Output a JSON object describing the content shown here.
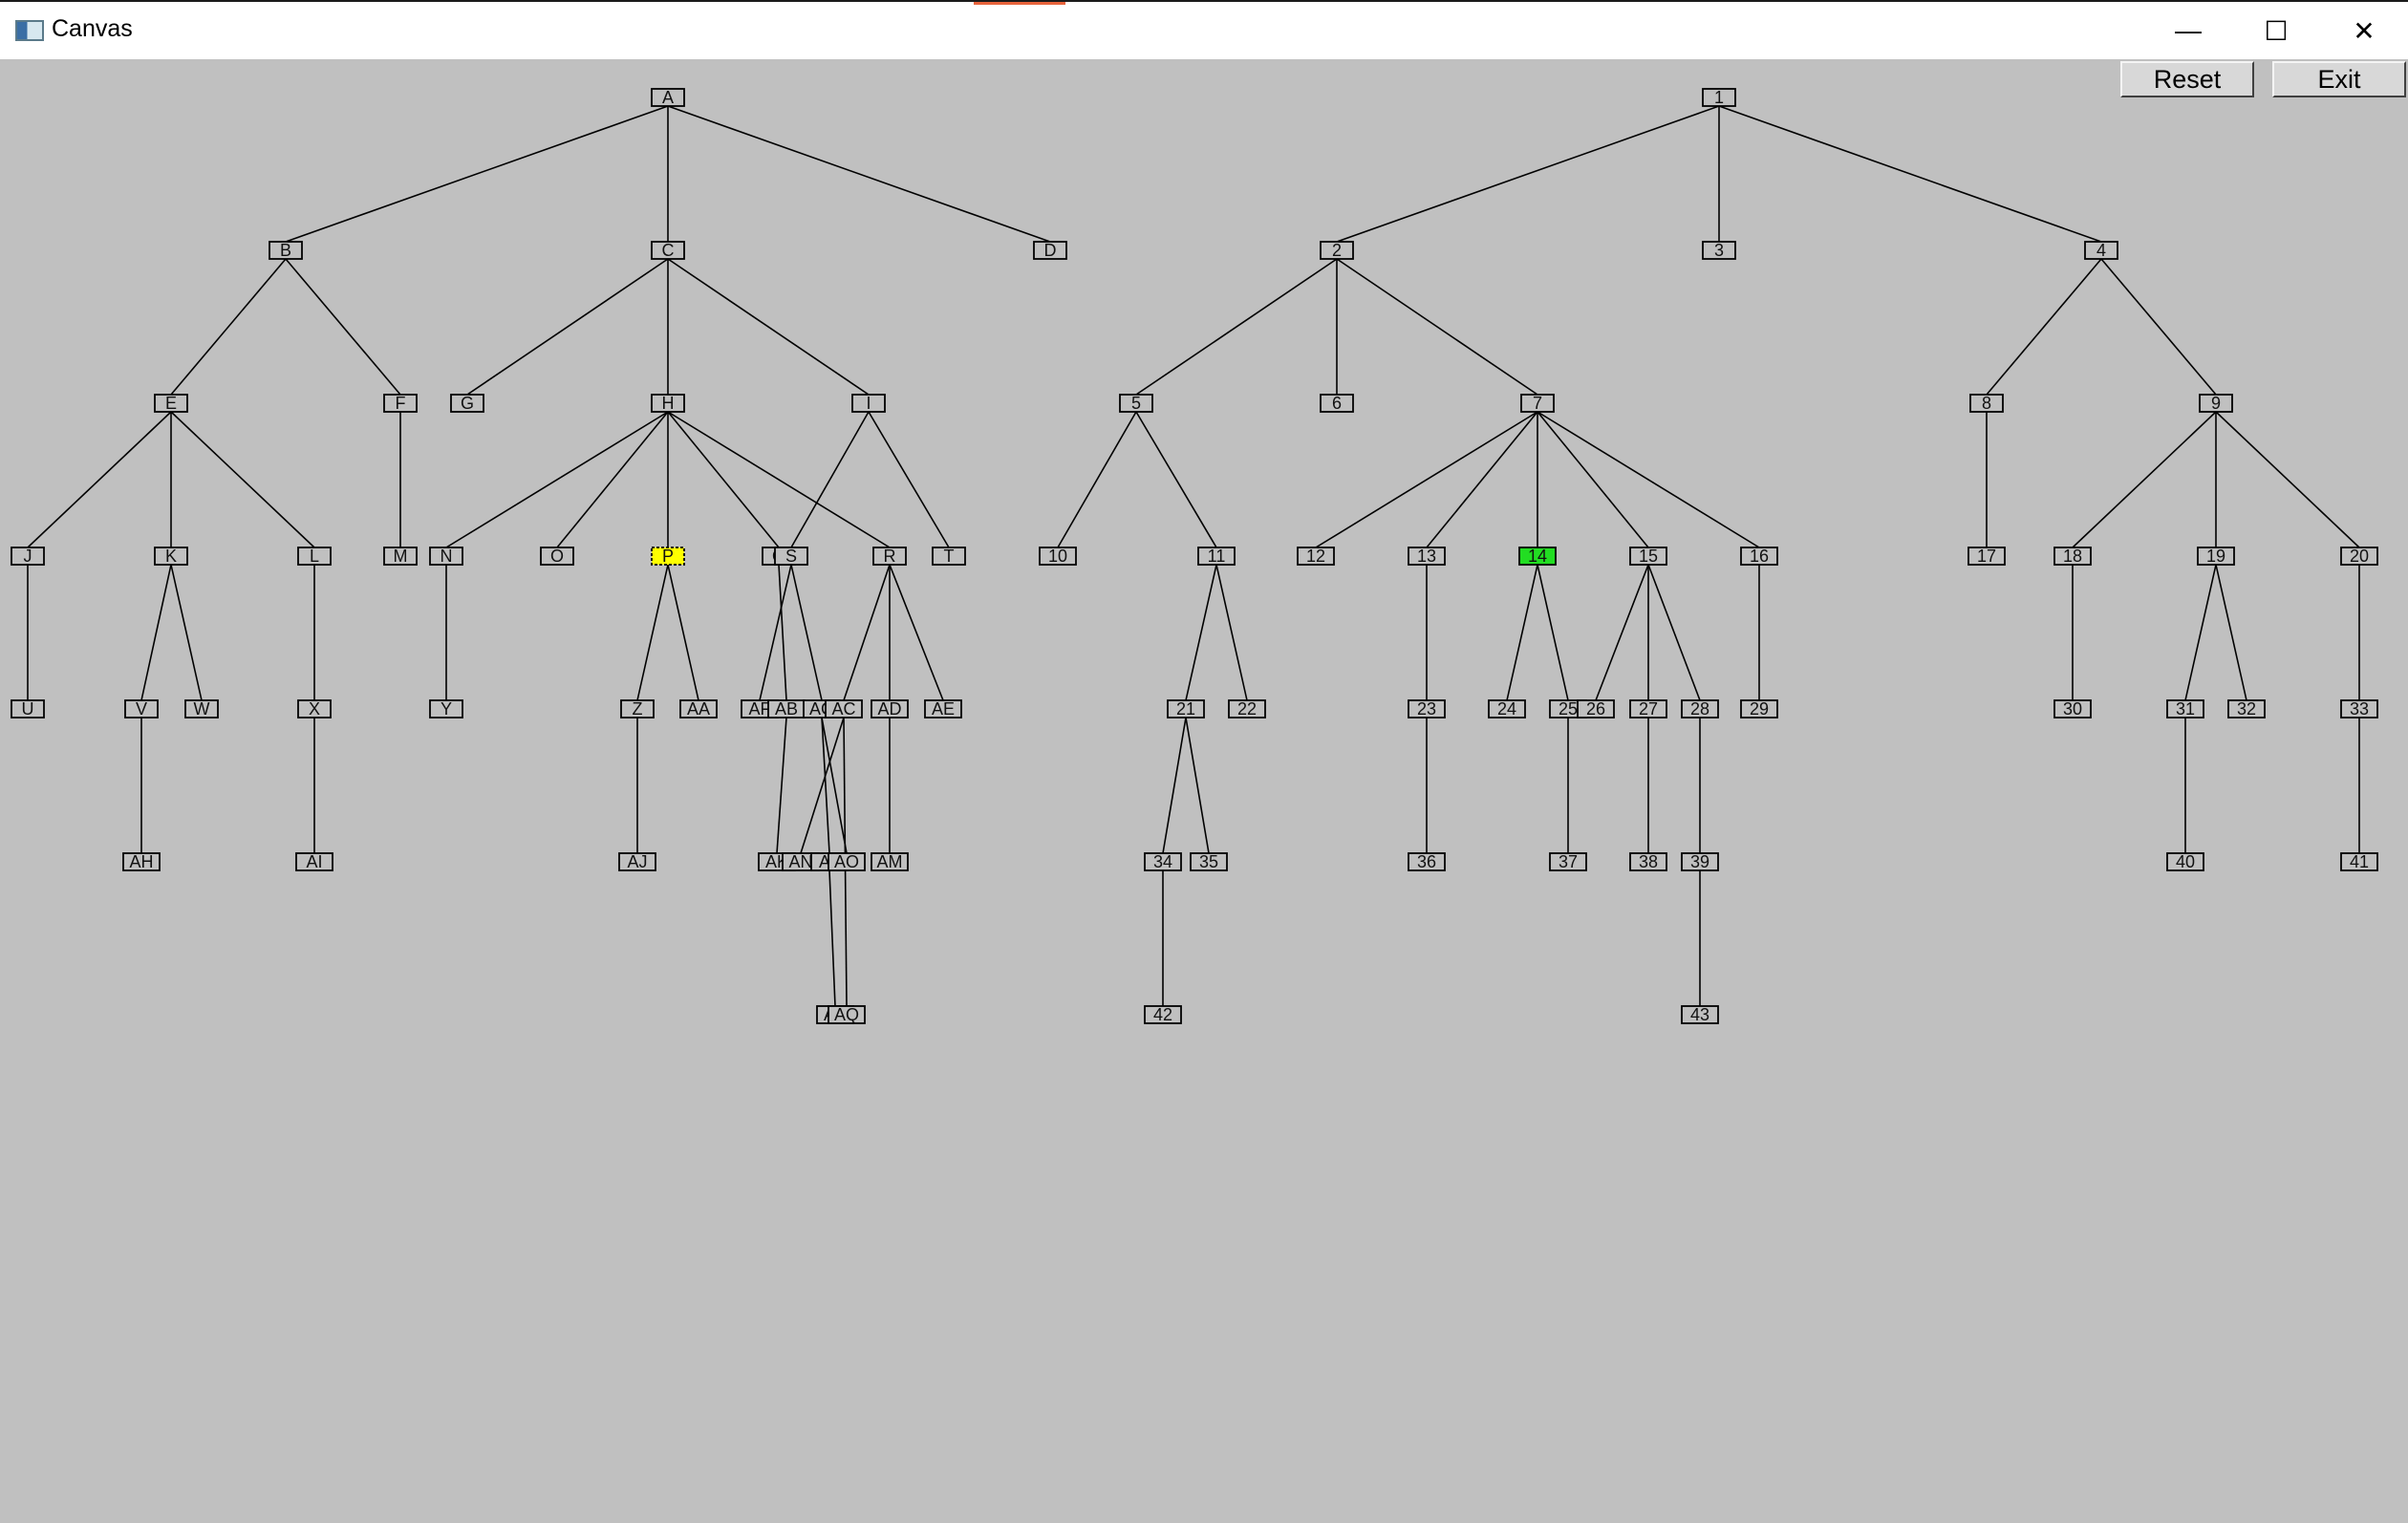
{
  "window": {
    "title": "Canvas",
    "icon": "canvas-app-icon",
    "controls": {
      "minimize": "—",
      "maximize": "☐",
      "close": "✕"
    }
  },
  "toolbar": {
    "reset_label": "Reset",
    "exit_label": "Exit"
  },
  "colors": {
    "background": "#c0c0c0",
    "node_fill": "#c0c0c0",
    "node_border": "#000000",
    "edge": "#000000",
    "highlight_yellow": "#ffff00",
    "highlight_green": "#22dd22"
  },
  "trees": [
    {
      "name": "letter-tree",
      "nodes": [
        {
          "label": "A"
        },
        {
          "label": "B",
          "parent": "A"
        },
        {
          "label": "C",
          "parent": "A"
        },
        {
          "label": "D",
          "parent": "A"
        },
        {
          "label": "E",
          "parent": "B"
        },
        {
          "label": "F",
          "parent": "B"
        },
        {
          "label": "G",
          "parent": "C"
        },
        {
          "label": "H",
          "parent": "C"
        },
        {
          "label": "I",
          "parent": "C"
        },
        {
          "label": "J",
          "parent": "E"
        },
        {
          "label": "K",
          "parent": "E"
        },
        {
          "label": "L",
          "parent": "E"
        },
        {
          "label": "M",
          "parent": "F"
        },
        {
          "label": "N",
          "parent": "H"
        },
        {
          "label": "O",
          "parent": "H"
        },
        {
          "label": "P",
          "parent": "H",
          "highlight": "yellow"
        },
        {
          "label": "Q",
          "parent": "H"
        },
        {
          "label": "R",
          "parent": "H"
        },
        {
          "label": "S",
          "parent": "I"
        },
        {
          "label": "T",
          "parent": "I"
        },
        {
          "label": "U",
          "parent": "J"
        },
        {
          "label": "V",
          "parent": "K"
        },
        {
          "label": "W",
          "parent": "K"
        },
        {
          "label": "X",
          "parent": "L"
        },
        {
          "label": "Y",
          "parent": "N"
        },
        {
          "label": "Z",
          "parent": "P"
        },
        {
          "label": "AA",
          "parent": "P"
        },
        {
          "label": "AF",
          "parent": "S"
        },
        {
          "label": "AB",
          "parent": "Q"
        },
        {
          "label": "AG",
          "parent": "S"
        },
        {
          "label": "AC",
          "parent": "R"
        },
        {
          "label": "AD",
          "parent": "R"
        },
        {
          "label": "AE",
          "parent": "R"
        },
        {
          "label": "AH",
          "parent": "V"
        },
        {
          "label": "AI",
          "parent": "X"
        },
        {
          "label": "AJ",
          "parent": "Z"
        },
        {
          "label": "AK",
          "parent": "AB"
        },
        {
          "label": "AN",
          "parent": "AC"
        },
        {
          "label": "AL",
          "parent": "AG"
        },
        {
          "label": "AO",
          "parent": "AG"
        },
        {
          "label": "AM",
          "parent": "AD"
        },
        {
          "label": "AP",
          "parent": "AL"
        },
        {
          "label": "AQ",
          "parent": "AC"
        }
      ]
    },
    {
      "name": "number-tree",
      "nodes": [
        {
          "label": "1"
        },
        {
          "label": "2",
          "parent": "1"
        },
        {
          "label": "3",
          "parent": "1"
        },
        {
          "label": "4",
          "parent": "1"
        },
        {
          "label": "5",
          "parent": "2"
        },
        {
          "label": "6",
          "parent": "2"
        },
        {
          "label": "7",
          "parent": "2"
        },
        {
          "label": "8",
          "parent": "4"
        },
        {
          "label": "9",
          "parent": "4"
        },
        {
          "label": "10",
          "parent": "5"
        },
        {
          "label": "11",
          "parent": "5"
        },
        {
          "label": "12",
          "parent": "7"
        },
        {
          "label": "13",
          "parent": "7"
        },
        {
          "label": "14",
          "parent": "7",
          "highlight": "green"
        },
        {
          "label": "15",
          "parent": "7"
        },
        {
          "label": "16",
          "parent": "7"
        },
        {
          "label": "17",
          "parent": "8"
        },
        {
          "label": "18",
          "parent": "9"
        },
        {
          "label": "19",
          "parent": "9"
        },
        {
          "label": "20",
          "parent": "9"
        },
        {
          "label": "21",
          "parent": "11"
        },
        {
          "label": "22",
          "parent": "11"
        },
        {
          "label": "23",
          "parent": "13"
        },
        {
          "label": "24",
          "parent": "14"
        },
        {
          "label": "25",
          "parent": "14"
        },
        {
          "label": "26",
          "parent": "15"
        },
        {
          "label": "27",
          "parent": "15"
        },
        {
          "label": "28",
          "parent": "15"
        },
        {
          "label": "29",
          "parent": "16"
        },
        {
          "label": "30",
          "parent": "18"
        },
        {
          "label": "31",
          "parent": "19"
        },
        {
          "label": "32",
          "parent": "19"
        },
        {
          "label": "33",
          "parent": "20"
        },
        {
          "label": "34",
          "parent": "21"
        },
        {
          "label": "35",
          "parent": "21"
        },
        {
          "label": "36",
          "parent": "23"
        },
        {
          "label": "37",
          "parent": "25"
        },
        {
          "label": "38",
          "parent": "27"
        },
        {
          "label": "39",
          "parent": "28"
        },
        {
          "label": "40",
          "parent": "31"
        },
        {
          "label": "41",
          "parent": "33"
        },
        {
          "label": "42",
          "parent": "34"
        },
        {
          "label": "43",
          "parent": "39"
        }
      ]
    }
  ]
}
